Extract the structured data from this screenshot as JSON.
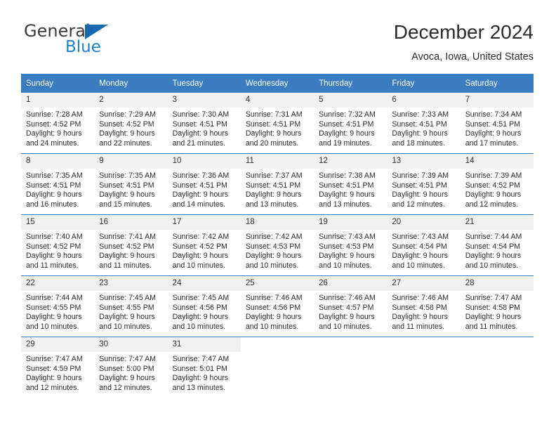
{
  "logo": {
    "word_one": "General",
    "word_two": "Blue",
    "triangle_color": "#1668b3",
    "blue_color": "#1b7fd4"
  },
  "header": {
    "title": "December 2024",
    "subtitle": "Avoca, Iowa, United States"
  },
  "theme": {
    "header_blue": "#3a7cc0",
    "daynum_gray": "#f1f1f1"
  },
  "calendar": {
    "weekdays": [
      "Sunday",
      "Monday",
      "Tuesday",
      "Wednesday",
      "Thursday",
      "Friday",
      "Saturday"
    ],
    "weeks": [
      [
        {
          "day": "1",
          "sunrise": "Sunrise: 7:28 AM",
          "sunset": "Sunset: 4:52 PM",
          "daylight_line1": "Daylight: 9 hours",
          "daylight_line2": "and 24 minutes."
        },
        {
          "day": "2",
          "sunrise": "Sunrise: 7:29 AM",
          "sunset": "Sunset: 4:52 PM",
          "daylight_line1": "Daylight: 9 hours",
          "daylight_line2": "and 22 minutes."
        },
        {
          "day": "3",
          "sunrise": "Sunrise: 7:30 AM",
          "sunset": "Sunset: 4:51 PM",
          "daylight_line1": "Daylight: 9 hours",
          "daylight_line2": "and 21 minutes."
        },
        {
          "day": "4",
          "sunrise": "Sunrise: 7:31 AM",
          "sunset": "Sunset: 4:51 PM",
          "daylight_line1": "Daylight: 9 hours",
          "daylight_line2": "and 20 minutes."
        },
        {
          "day": "5",
          "sunrise": "Sunrise: 7:32 AM",
          "sunset": "Sunset: 4:51 PM",
          "daylight_line1": "Daylight: 9 hours",
          "daylight_line2": "and 19 minutes."
        },
        {
          "day": "6",
          "sunrise": "Sunrise: 7:33 AM",
          "sunset": "Sunset: 4:51 PM",
          "daylight_line1": "Daylight: 9 hours",
          "daylight_line2": "and 18 minutes."
        },
        {
          "day": "7",
          "sunrise": "Sunrise: 7:34 AM",
          "sunset": "Sunset: 4:51 PM",
          "daylight_line1": "Daylight: 9 hours",
          "daylight_line2": "and 17 minutes."
        }
      ],
      [
        {
          "day": "8",
          "sunrise": "Sunrise: 7:35 AM",
          "sunset": "Sunset: 4:51 PM",
          "daylight_line1": "Daylight: 9 hours",
          "daylight_line2": "and 16 minutes."
        },
        {
          "day": "9",
          "sunrise": "Sunrise: 7:35 AM",
          "sunset": "Sunset: 4:51 PM",
          "daylight_line1": "Daylight: 9 hours",
          "daylight_line2": "and 15 minutes."
        },
        {
          "day": "10",
          "sunrise": "Sunrise: 7:36 AM",
          "sunset": "Sunset: 4:51 PM",
          "daylight_line1": "Daylight: 9 hours",
          "daylight_line2": "and 14 minutes."
        },
        {
          "day": "11",
          "sunrise": "Sunrise: 7:37 AM",
          "sunset": "Sunset: 4:51 PM",
          "daylight_line1": "Daylight: 9 hours",
          "daylight_line2": "and 13 minutes."
        },
        {
          "day": "12",
          "sunrise": "Sunrise: 7:38 AM",
          "sunset": "Sunset: 4:51 PM",
          "daylight_line1": "Daylight: 9 hours",
          "daylight_line2": "and 13 minutes."
        },
        {
          "day": "13",
          "sunrise": "Sunrise: 7:39 AM",
          "sunset": "Sunset: 4:51 PM",
          "daylight_line1": "Daylight: 9 hours",
          "daylight_line2": "and 12 minutes."
        },
        {
          "day": "14",
          "sunrise": "Sunrise: 7:39 AM",
          "sunset": "Sunset: 4:52 PM",
          "daylight_line1": "Daylight: 9 hours",
          "daylight_line2": "and 12 minutes."
        }
      ],
      [
        {
          "day": "15",
          "sunrise": "Sunrise: 7:40 AM",
          "sunset": "Sunset: 4:52 PM",
          "daylight_line1": "Daylight: 9 hours",
          "daylight_line2": "and 11 minutes."
        },
        {
          "day": "16",
          "sunrise": "Sunrise: 7:41 AM",
          "sunset": "Sunset: 4:52 PM",
          "daylight_line1": "Daylight: 9 hours",
          "daylight_line2": "and 11 minutes."
        },
        {
          "day": "17",
          "sunrise": "Sunrise: 7:42 AM",
          "sunset": "Sunset: 4:52 PM",
          "daylight_line1": "Daylight: 9 hours",
          "daylight_line2": "and 10 minutes."
        },
        {
          "day": "18",
          "sunrise": "Sunrise: 7:42 AM",
          "sunset": "Sunset: 4:53 PM",
          "daylight_line1": "Daylight: 9 hours",
          "daylight_line2": "and 10 minutes."
        },
        {
          "day": "19",
          "sunrise": "Sunrise: 7:43 AM",
          "sunset": "Sunset: 4:53 PM",
          "daylight_line1": "Daylight: 9 hours",
          "daylight_line2": "and 10 minutes."
        },
        {
          "day": "20",
          "sunrise": "Sunrise: 7:43 AM",
          "sunset": "Sunset: 4:54 PM",
          "daylight_line1": "Daylight: 9 hours",
          "daylight_line2": "and 10 minutes."
        },
        {
          "day": "21",
          "sunrise": "Sunrise: 7:44 AM",
          "sunset": "Sunset: 4:54 PM",
          "daylight_line1": "Daylight: 9 hours",
          "daylight_line2": "and 10 minutes."
        }
      ],
      [
        {
          "day": "22",
          "sunrise": "Sunrise: 7:44 AM",
          "sunset": "Sunset: 4:55 PM",
          "daylight_line1": "Daylight: 9 hours",
          "daylight_line2": "and 10 minutes."
        },
        {
          "day": "23",
          "sunrise": "Sunrise: 7:45 AM",
          "sunset": "Sunset: 4:55 PM",
          "daylight_line1": "Daylight: 9 hours",
          "daylight_line2": "and 10 minutes."
        },
        {
          "day": "24",
          "sunrise": "Sunrise: 7:45 AM",
          "sunset": "Sunset: 4:56 PM",
          "daylight_line1": "Daylight: 9 hours",
          "daylight_line2": "and 10 minutes."
        },
        {
          "day": "25",
          "sunrise": "Sunrise: 7:46 AM",
          "sunset": "Sunset: 4:56 PM",
          "daylight_line1": "Daylight: 9 hours",
          "daylight_line2": "and 10 minutes."
        },
        {
          "day": "26",
          "sunrise": "Sunrise: 7:46 AM",
          "sunset": "Sunset: 4:57 PM",
          "daylight_line1": "Daylight: 9 hours",
          "daylight_line2": "and 10 minutes."
        },
        {
          "day": "27",
          "sunrise": "Sunrise: 7:46 AM",
          "sunset": "Sunset: 4:58 PM",
          "daylight_line1": "Daylight: 9 hours",
          "daylight_line2": "and 11 minutes."
        },
        {
          "day": "28",
          "sunrise": "Sunrise: 7:47 AM",
          "sunset": "Sunset: 4:58 PM",
          "daylight_line1": "Daylight: 9 hours",
          "daylight_line2": "and 11 minutes."
        }
      ],
      [
        {
          "day": "29",
          "sunrise": "Sunrise: 7:47 AM",
          "sunset": "Sunset: 4:59 PM",
          "daylight_line1": "Daylight: 9 hours",
          "daylight_line2": "and 12 minutes."
        },
        {
          "day": "30",
          "sunrise": "Sunrise: 7:47 AM",
          "sunset": "Sunset: 5:00 PM",
          "daylight_line1": "Daylight: 9 hours",
          "daylight_line2": "and 12 minutes."
        },
        {
          "day": "31",
          "sunrise": "Sunrise: 7:47 AM",
          "sunset": "Sunset: 5:01 PM",
          "daylight_line1": "Daylight: 9 hours",
          "daylight_line2": "and 13 minutes."
        },
        {
          "day": "",
          "sunrise": "",
          "sunset": "",
          "daylight_line1": "",
          "daylight_line2": ""
        },
        {
          "day": "",
          "sunrise": "",
          "sunset": "",
          "daylight_line1": "",
          "daylight_line2": ""
        },
        {
          "day": "",
          "sunrise": "",
          "sunset": "",
          "daylight_line1": "",
          "daylight_line2": ""
        },
        {
          "day": "",
          "sunrise": "",
          "sunset": "",
          "daylight_line1": "",
          "daylight_line2": ""
        }
      ]
    ]
  }
}
